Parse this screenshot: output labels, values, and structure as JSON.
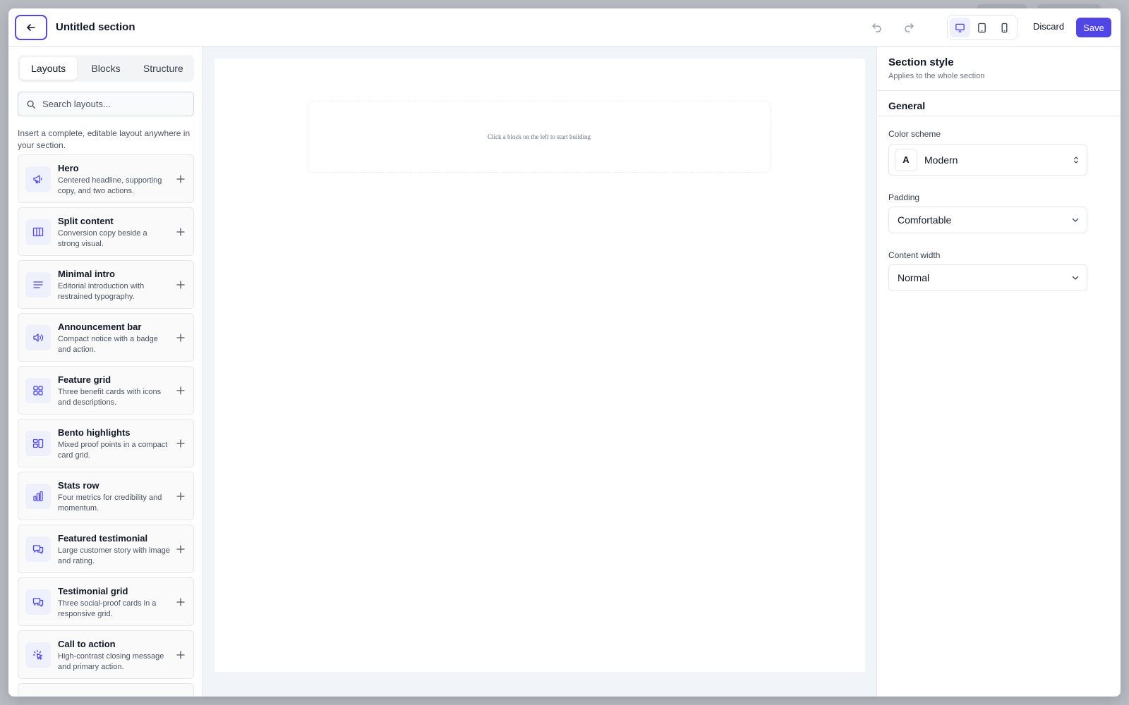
{
  "header": {
    "title": "Untitled section",
    "discard_label": "Discard",
    "save_label": "Save",
    "accent_color": "#4f46e5"
  },
  "left_panel": {
    "tabs": [
      {
        "label": "Layouts",
        "active": true
      },
      {
        "label": "Blocks",
        "active": false
      },
      {
        "label": "Structure",
        "active": false
      }
    ],
    "search": {
      "placeholder": "Search layouts...",
      "value": ""
    },
    "hint": "Insert a complete, editable layout anywhere in your section.",
    "layouts": [
      {
        "icon": "megaphone-icon",
        "title": "Hero",
        "description": "Centered headline, supporting copy, and two actions."
      },
      {
        "icon": "columns-icon",
        "title": "Split content",
        "description": "Conversion copy beside a strong visual."
      },
      {
        "icon": "text-lines-icon",
        "title": "Minimal intro",
        "description": "Editorial introduction with restrained typography."
      },
      {
        "icon": "speaker-icon",
        "title": "Announcement bar",
        "description": "Compact notice with a badge and action."
      },
      {
        "icon": "grid-icon",
        "title": "Feature grid",
        "description": "Three benefit cards with icons and descriptions."
      },
      {
        "icon": "bento-icon",
        "title": "Bento highlights",
        "description": "Mixed proof points in a compact card grid."
      },
      {
        "icon": "bar-chart-icon",
        "title": "Stats row",
        "description": "Four metrics for credibility and momentum."
      },
      {
        "icon": "chat-bubbles-icon",
        "title": "Featured testimonial",
        "description": "Large customer story with image and rating."
      },
      {
        "icon": "chat-bubbles-icon",
        "title": "Testimonial grid",
        "description": "Three social-proof cards in a responsive grid."
      },
      {
        "icon": "cursor-click-icon",
        "title": "Call to action",
        "description": "High-contrast closing message and primary action."
      }
    ]
  },
  "canvas": {
    "empty_message": "Click a block on the left to start building"
  },
  "right_panel": {
    "title": "Section style",
    "subtitle": "Applies to the whole section",
    "group": "General",
    "color_scheme": {
      "label": "Color scheme",
      "badge": "A",
      "value": "Modern"
    },
    "padding": {
      "label": "Padding",
      "value": "Comfortable"
    },
    "content_width": {
      "label": "Content width",
      "value": "Normal"
    }
  }
}
